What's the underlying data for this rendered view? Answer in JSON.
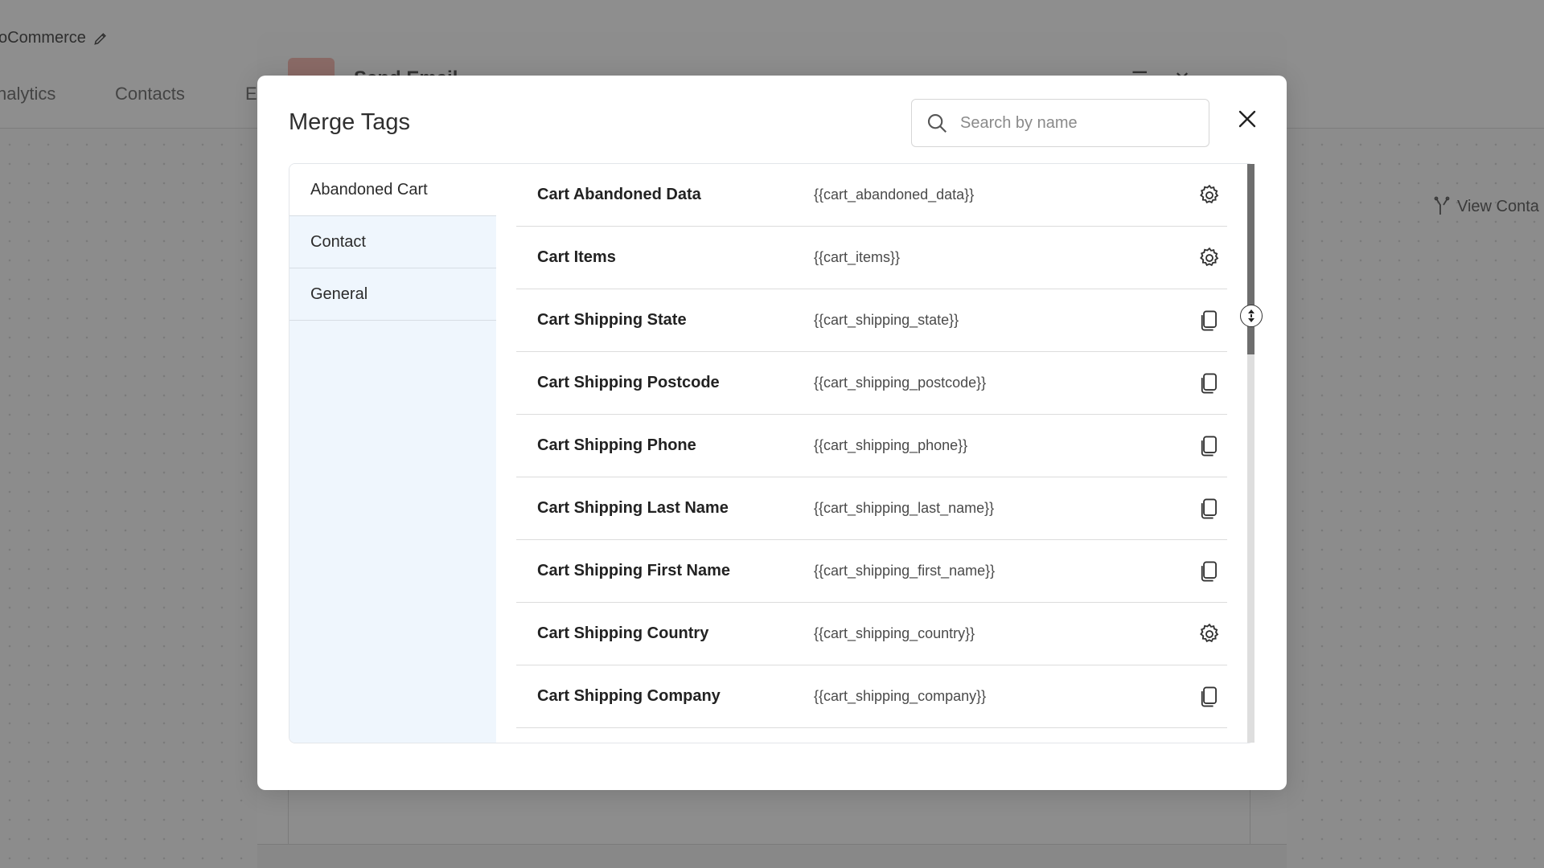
{
  "background": {
    "app_title": "oCommerce",
    "nav": [
      "nalytics",
      "Contacts",
      "E"
    ],
    "panel_title": "Send Email",
    "view_contact": "View Conta"
  },
  "modal": {
    "title": "Merge Tags",
    "search": {
      "placeholder": "Search by name",
      "value": ""
    },
    "sidebar": [
      {
        "label": "Abandoned Cart",
        "active": true
      },
      {
        "label": "Contact",
        "active": false
      },
      {
        "label": "General",
        "active": false
      }
    ],
    "tags": [
      {
        "name": "Cart Abandoned Data",
        "code": "{{cart_abandoned_data}}",
        "icon": "gear-icon"
      },
      {
        "name": "Cart Items",
        "code": "{{cart_items}}",
        "icon": "gear-icon"
      },
      {
        "name": "Cart Shipping State",
        "code": "{{cart_shipping_state}}",
        "icon": "copy-icon"
      },
      {
        "name": "Cart Shipping Postcode",
        "code": "{{cart_shipping_postcode}}",
        "icon": "copy-icon"
      },
      {
        "name": "Cart Shipping Phone",
        "code": "{{cart_shipping_phone}}",
        "icon": "copy-icon"
      },
      {
        "name": "Cart Shipping Last Name",
        "code": "{{cart_shipping_last_name}}",
        "icon": "copy-icon"
      },
      {
        "name": "Cart Shipping First Name",
        "code": "{{cart_shipping_first_name}}",
        "icon": "copy-icon"
      },
      {
        "name": "Cart Shipping Country",
        "code": "{{cart_shipping_country}}",
        "icon": "gear-icon"
      },
      {
        "name": "Cart Shipping Company",
        "code": "{{cart_shipping_company}}",
        "icon": "copy-icon"
      }
    ]
  }
}
